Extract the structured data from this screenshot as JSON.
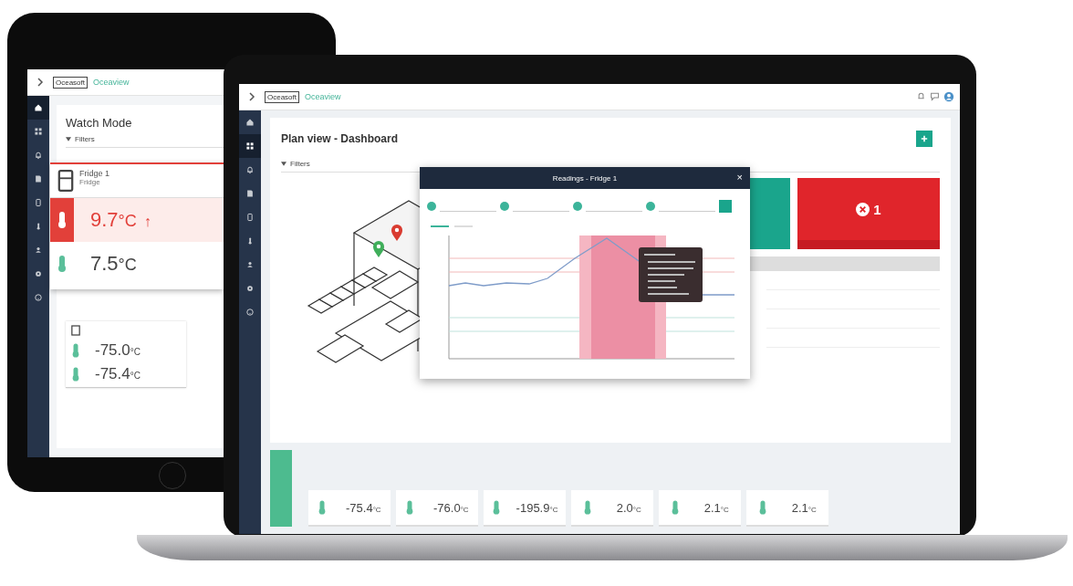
{
  "tablet": {
    "header": {
      "logo": "Oceasoft",
      "app_name": "Oceaview"
    },
    "sidebar": [
      {
        "kind": "home",
        "selected": true
      },
      {
        "kind": "grid",
        "selected": false
      },
      {
        "kind": "bell",
        "selected": false
      },
      {
        "kind": "document",
        "selected": false
      },
      {
        "kind": "tablet",
        "selected": false
      },
      {
        "kind": "thermometer",
        "selected": false
      },
      {
        "kind": "person",
        "selected": false
      },
      {
        "kind": "gear",
        "selected": false
      },
      {
        "kind": "help",
        "selected": false
      }
    ],
    "title": "Watch Mode",
    "filters": "Filters",
    "popup": {
      "name": "Fridge 1",
      "type": "Fridge",
      "sensors": [
        {
          "alarm": true,
          "reading": "9.7",
          "unit": "°C",
          "trend": "↑"
        },
        {
          "alarm": false,
          "reading": "7.5",
          "unit": "°C"
        }
      ]
    },
    "cards": [
      {
        "readings": [
          {
            "value": "-75.0",
            "unit": "°C"
          },
          {
            "value": "-75.4",
            "unit": "°C"
          }
        ]
      }
    ]
  },
  "laptop": {
    "header": {
      "logo": "Oceasoft",
      "app_name": "Oceaview"
    },
    "sidebar": [
      {
        "kind": "home",
        "selected": false
      },
      {
        "kind": "grid",
        "selected": true
      },
      {
        "kind": "bell",
        "selected": false
      },
      {
        "kind": "document",
        "selected": false
      },
      {
        "kind": "tablet",
        "selected": false
      },
      {
        "kind": "thermometer",
        "selected": false
      },
      {
        "kind": "person",
        "selected": false
      },
      {
        "kind": "gear",
        "selected": false
      },
      {
        "kind": "help",
        "selected": false
      }
    ],
    "title": "Plan view - Dashboard",
    "filters": "Filters",
    "pins": [
      {
        "color": "#3fae5a"
      },
      {
        "color": "#d93b30"
      }
    ],
    "tiles": [
      {
        "color": "#1aa58c"
      },
      {
        "color": "#e0252b",
        "count": "1"
      }
    ],
    "modal": {
      "title": "Readings - Fridge 1",
      "close": "×"
    },
    "sensor_cards": [
      {
        "value": "-75.4",
        "unit": "°C"
      },
      {
        "value": "-76.0",
        "unit": "°C"
      },
      {
        "value": "-195.9",
        "unit": "°C"
      },
      {
        "value": "2.0",
        "unit": "°C"
      },
      {
        "value": "2.1",
        "unit": "°C"
      },
      {
        "value": "2.1",
        "unit": "°C"
      }
    ]
  }
}
